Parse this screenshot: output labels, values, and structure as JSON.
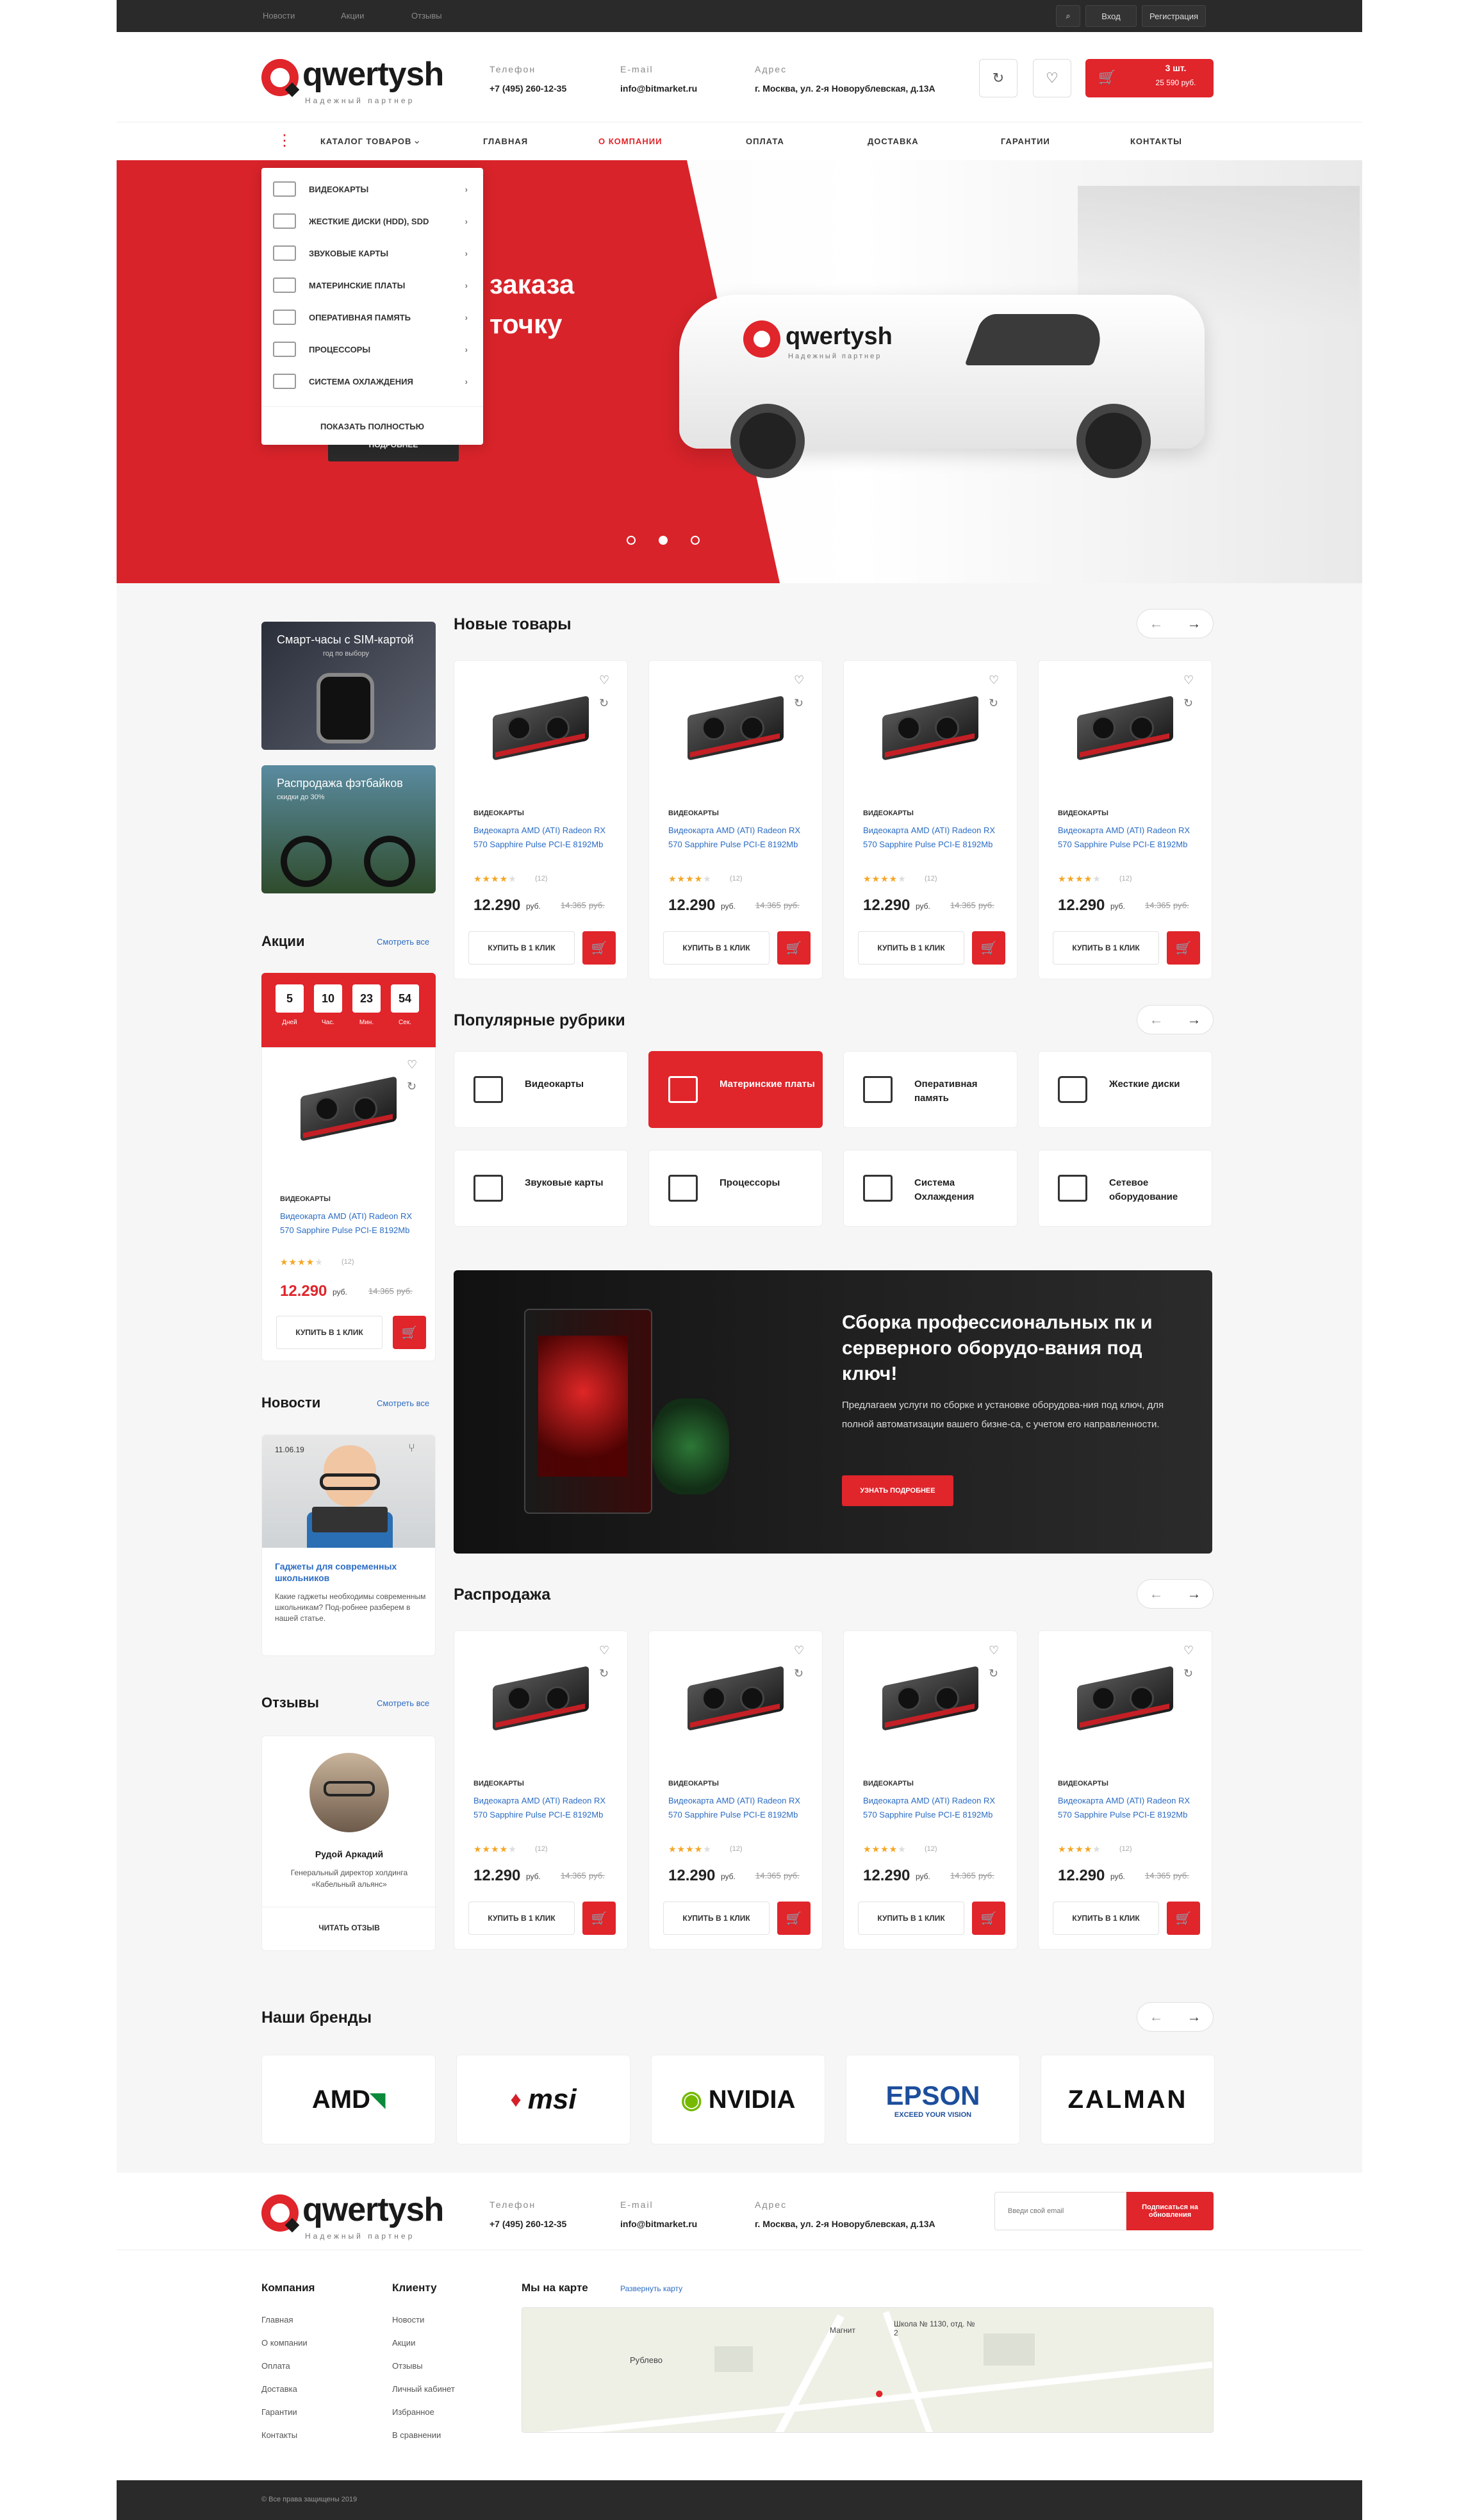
{
  "topbar": {
    "links": [
      "Новости",
      "Акции",
      "Отзывы"
    ],
    "login": "Вход",
    "register": "Регистрация"
  },
  "header": {
    "logo": "qwertysh",
    "tagline": "Надежный партнер",
    "phone_label": "Телефон",
    "phone": "+7 (495) 260-12-35",
    "email_label": "E-mail",
    "email": "info@bitmarket.ru",
    "address_label": "Адрес",
    "address": "г. Москва, ул. 2-я Новорублевская, д.13А",
    "cart_count": "3 шт.",
    "cart_sum": "25 590 руб."
  },
  "nav": {
    "catalog": "КАТАЛОГ ТОВАРОВ",
    "items": [
      "ГЛАВНАЯ",
      "О КОМПАНИИ",
      "ОПЛАТА",
      "ДОСТАВКА",
      "ГАРАНТИИ",
      "КОНТАКТЫ"
    ],
    "active_color": "#e0252b"
  },
  "catalog_menu": {
    "items": [
      "ВИДЕОКАРТЫ",
      "ЖЕСТКИЕ ДИСКИ (HDD), SDD",
      "ЗВУКОВЫЕ КАРТЫ",
      "МАТЕРИНСКИЕ ПЛАТЫ",
      "ОПЕРАТИВНАЯ ПАМЯТЬ",
      "ПРОЦЕССОРЫ",
      "СИСТЕМА ОХЛАЖДЕНИЯ"
    ],
    "show_all": "ПОКАЗАТЬ ПОЛНОСТЬЮ"
  },
  "hero": {
    "title_line1": "заказа",
    "title_line2": "точку",
    "button": "ПОДРОБНЕЕ",
    "van_logo": "qwertysh",
    "van_tagline": "Надежный партнер",
    "dots": 3,
    "active_dot": 2
  },
  "side_banners": [
    {
      "title": "Смарт-часы с SIM-картой",
      "sub": "год по выбору"
    },
    {
      "title": "Распродажа фэтбайков",
      "sub": "скидки до 30%"
    }
  ],
  "promo": {
    "title": "Акции",
    "all": "Смотреть все",
    "timer": [
      {
        "v": "5",
        "l": "Дней"
      },
      {
        "v": "10",
        "l": "Час."
      },
      {
        "v": "23",
        "l": "Мин."
      },
      {
        "v": "54",
        "l": "Сек."
      }
    ],
    "product": {
      "cat": "ВИДЕОКАРТЫ",
      "name": "Видеокарта AMD (ATI) Radeon RX 570 Sapphire Pulse PCI-E 8192Mb",
      "price": "12.290",
      "rub": "руб.",
      "old": "14.365",
      "old_rub": "руб.",
      "count": "(12)",
      "buy": "КУПИТЬ В 1 КЛИК"
    }
  },
  "new_products": {
    "title": "Новые товары",
    "items": [
      {
        "cat": "ВИДЕОКАРТЫ",
        "name": "Видеокарта AMD (ATI) Radeon RX 570 Sapphire Pulse PCI-E 8192Mb",
        "price": "12.290",
        "rub": "руб.",
        "old": "14.365",
        "old_rub": "руб.",
        "count": "(12)",
        "buy": "КУПИТЬ В 1 КЛИК"
      },
      {
        "cat": "ВИДЕОКАРТЫ",
        "name": "Видеокарта AMD (ATI) Radeon RX 570 Sapphire Pulse PCI-E 8192Mb",
        "price": "12.290",
        "rub": "руб.",
        "old": "14.365",
        "old_rub": "руб.",
        "count": "(12)",
        "buy": "КУПИТЬ В 1 КЛИК"
      },
      {
        "cat": "ВИДЕОКАРТЫ",
        "name": "Видеокарта AMD (ATI) Radeon RX 570 Sapphire Pulse PCI-E 8192Mb",
        "price": "12.290",
        "rub": "руб.",
        "old": "14.365",
        "old_rub": "руб.",
        "count": "(12)",
        "buy": "КУПИТЬ В 1 КЛИК"
      },
      {
        "cat": "ВИДЕОКАРТЫ",
        "name": "Видеокарта AMD (ATI) Radeon RX 570 Sapphire Pulse PCI-E 8192Mb",
        "price": "12.290",
        "rub": "руб.",
        "old": "14.365",
        "old_rub": "руб.",
        "count": "(12)",
        "buy": "КУПИТЬ В 1 КЛИК"
      }
    ]
  },
  "popular": {
    "title": "Популярные рубрики",
    "items": [
      "Видеокарты",
      "Материнские платы",
      "Оперативная память",
      "Жесткие диски",
      "Звуковые карты",
      "Процессоры",
      "Система Охлаждения",
      "Сетевое оборудование"
    ]
  },
  "assembly": {
    "title": "Сборка профессиональных пк и серверного оборудо-вания под ключ!",
    "text": "Предлагаем услуги по сборке и установке оборудова-ния под ключ, для полной автоматизации вашего бизне-са, с учетом его направленности.",
    "button": "УЗНАТЬ ПОДРОБНЕЕ"
  },
  "news": {
    "title": "Новости",
    "all": "Смотреть все",
    "date": "11.06.19",
    "headline": "Гаджеты для современных школьников",
    "text": "Какие гаджеты необходимы современным школьникам? Под-робнее разберем в нашей статье."
  },
  "sale": {
    "title": "Распродажа",
    "items": [
      {
        "cat": "ВИДЕОКАРТЫ",
        "name": "Видеокарта AMD (ATI) Radeon RX 570 Sapphire Pulse PCI-E 8192Mb",
        "price": "12.290",
        "rub": "руб.",
        "old": "14.365",
        "old_rub": "руб.",
        "count": "(12)",
        "buy": "КУПИТЬ В 1 КЛИК"
      },
      {
        "cat": "ВИДЕОКАРТЫ",
        "name": "Видеокарта AMD (ATI) Radeon RX 570 Sapphire Pulse PCI-E 8192Mb",
        "price": "12.290",
        "rub": "руб.",
        "old": "14.365",
        "old_rub": "руб.",
        "count": "(12)",
        "buy": "КУПИТЬ В 1 КЛИК"
      },
      {
        "cat": "ВИДЕОКАРТЫ",
        "name": "Видеокарта AMD (ATI) Radeon RX 570 Sapphire Pulse PCI-E 8192Mb",
        "price": "12.290",
        "rub": "руб.",
        "old": "14.365",
        "old_rub": "руб.",
        "count": "(12)",
        "buy": "КУПИТЬ В 1 КЛИК"
      },
      {
        "cat": "ВИДЕОКАРТЫ",
        "name": "Видеокарта AMD (ATI) Radeon RX 570 Sapphire Pulse PCI-E 8192Mb",
        "price": "12.290",
        "rub": "руб.",
        "old": "14.365",
        "old_rub": "руб.",
        "count": "(12)",
        "buy": "КУПИТЬ В 1 КЛИК"
      }
    ]
  },
  "reviews": {
    "title": "Отзывы",
    "all": "Смотреть все",
    "name": "Рудой Аркадий",
    "position": "Генеральный директор холдинга «Кабельный альянс»",
    "read": "ЧИТАТЬ ОТЗЫВ"
  },
  "brands": {
    "title": "Наши бренды",
    "items": [
      "AMD",
      "msi",
      "NVIDIA",
      "EPSON",
      "ZALMAN"
    ],
    "epson_sub": "EXCEED YOUR VISION"
  },
  "footer": {
    "subscribe_placeholder": "Введи свой email",
    "subscribe_button": "Подписаться на обновления",
    "company_title": "Компания",
    "company": [
      "Главная",
      "О компании",
      "Оплата",
      "Доставка",
      "Гарантии",
      "Контакты"
    ],
    "client_title": "Клиенту",
    "client": [
      "Новости",
      "Акции",
      "Отзывы",
      "Личный кабинет",
      "Избранное",
      "В сравнении"
    ],
    "map_title": "Мы на карте",
    "map_expand": "Развернуть карту",
    "map_labels": [
      "Магнит",
      "Школа № 1130, отд. № 2",
      "Рублево"
    ],
    "copyright": "© Все права защищены 2019"
  },
  "colors": {
    "accent": "#e0252b",
    "link": "#2b6cc4",
    "dark": "#2a2a2a"
  }
}
